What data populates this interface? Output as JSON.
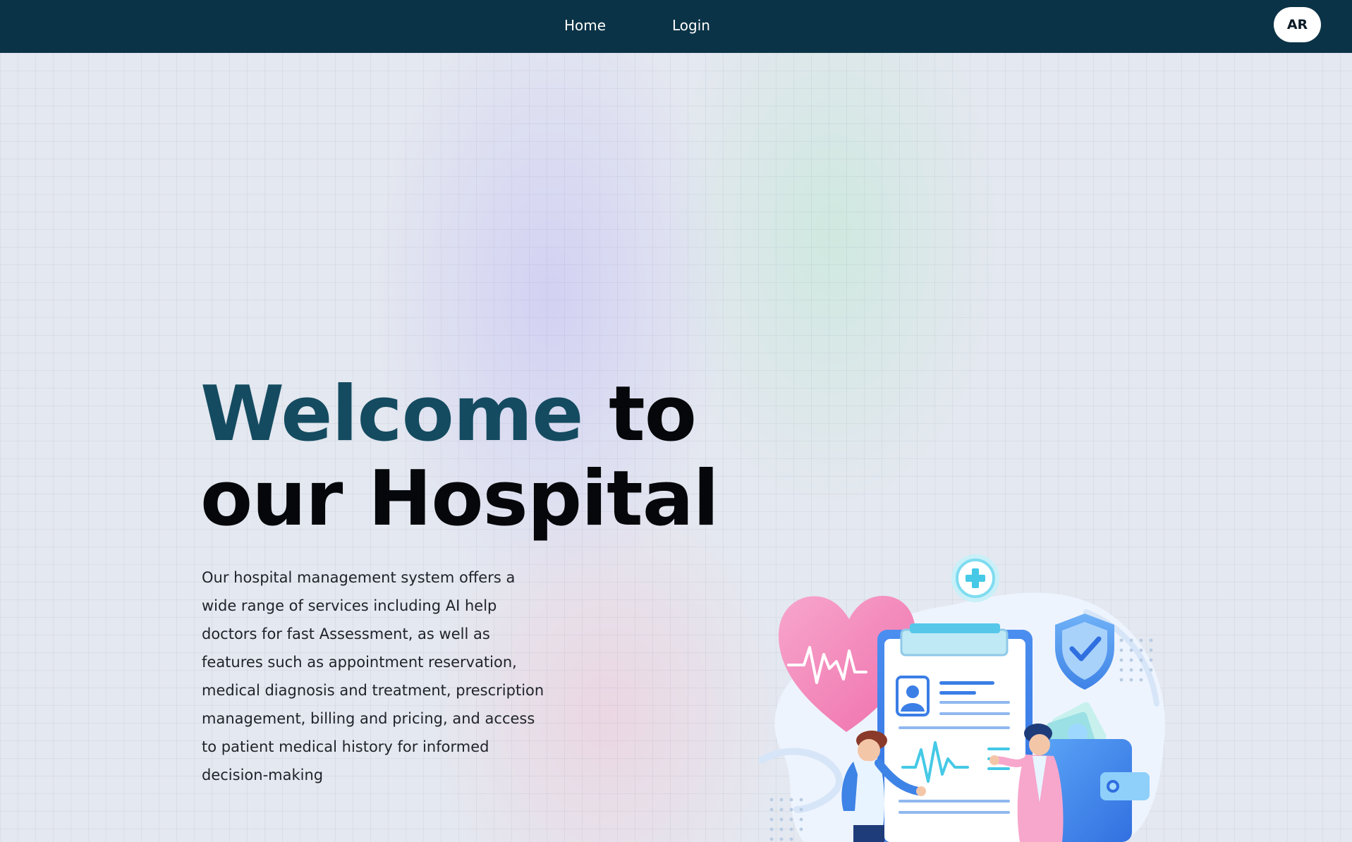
{
  "nav": {
    "home_label": "Home",
    "login_label": "Login",
    "language_label": "AR"
  },
  "hero": {
    "title_accent": "Welcome",
    "title_rest_1": "to",
    "title_rest_2": "our Hospital",
    "description": "Our hospital management system offers a wide range of services including AI help doctors for fast Assessment, as well as features such as appointment reservation, medical diagnosis and treatment, prescription management, billing and pricing, and access to patient medical history for informed decision-making"
  },
  "colors": {
    "navbar": "#0b3347",
    "title_accent": "#144b60",
    "title_text": "#05070a",
    "body_text": "#20242a"
  },
  "icons": [
    "heart-pulse-icon",
    "medical-cross-icon",
    "shield-check-icon",
    "clipboard-icon",
    "wallet-icon"
  ]
}
